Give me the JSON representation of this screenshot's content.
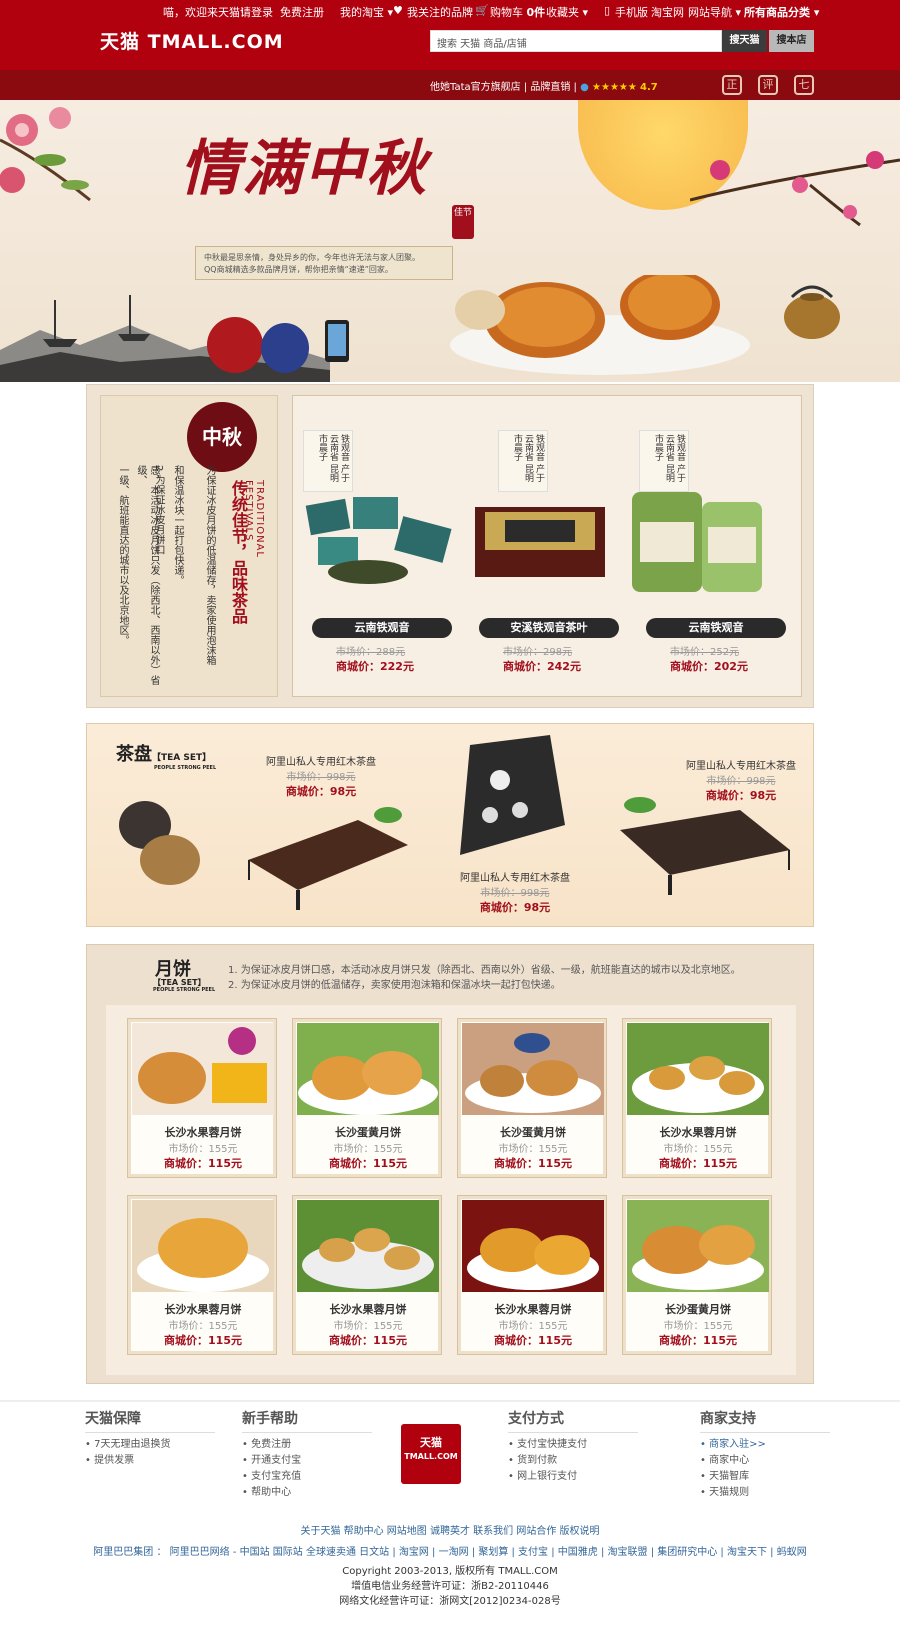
{
  "topnav": {
    "welcome": "喵，欢迎来天猫!",
    "login": "请登录",
    "register": "免费注册",
    "my_taobao": "我的淘宝",
    "fav_brands": "我关注的品牌",
    "cart": "购物车",
    "cart_count": "0件",
    "favorites": "收藏夹",
    "mobile": "手机版",
    "taobao": "淘宝网",
    "site_nav": "网站导航",
    "all_categories": "所有商品分类"
  },
  "logo": "天猫 TMALL.COM",
  "search": {
    "value": "搜索 天猫 商品/店铺",
    "btn_tmall": "搜天猫",
    "btn_shop": "搜本店"
  },
  "shop": {
    "name": "他她Tata官方旗舰店",
    "tag": "品牌直销",
    "stars": "★★★★★",
    "score": "4.7",
    "icons": [
      "正",
      "评",
      "七"
    ]
  },
  "banner": {
    "title": "情满中秋",
    "seal": "佳节",
    "note_line1": "中秋最是思亲情，身处异乡的你，今年也许无法与家人团聚。",
    "note_line2": "QQ商城精选多款品牌月饼，帮你把亲情“速递”回家。"
  },
  "sec1": {
    "seal": "中秋",
    "title": "传统佳节，品味茶品",
    "eng": "TRADITIONAL FESTIVALS",
    "text_cols": [
      "为保证冰皮月饼的低温储存，卖家使用泡沫箱",
      "和保温冰块一起打包快递。",
      "2.为保证冰皮月饼口",
      "感，本活动冰皮月饼只发（除西北、西南以外）省级、",
      "一级、航班能直达的城市以及北京地区。"
    ],
    "teas": [
      {
        "labels": "铁观音 产于云南省 昆明市晨子",
        "name": "云南铁观音",
        "market": "市场价：288元",
        "sale": "商城价：222元"
      },
      {
        "labels": "铁观音 产于云南省 昆明市晨子",
        "name": "安溪铁观音茶叶",
        "market": "市场价：298元",
        "sale": "商城价：242元"
      },
      {
        "labels": "铁观音 产于云南省 昆明市晨子",
        "name": "云南铁观音",
        "market": "市场价：252元",
        "sale": "商城价：202元"
      }
    ]
  },
  "sec2": {
    "label": "茶盘",
    "label_en": "【TEA SET】",
    "label_sub": "PEOPLE STRONG PEEL",
    "products": [
      {
        "name": "阿里山私人专用红木茶盘",
        "market": "市场价：998元",
        "sale": "商城价：98元"
      },
      {
        "name": "阿里山私人专用红木茶盘",
        "market": "市场价：998元",
        "sale": "商城价：98元"
      },
      {
        "name": "阿里山私人专用红木茶盘",
        "market": "市场价：998元",
        "sale": "商城价：98元"
      }
    ]
  },
  "sec3": {
    "label": "月饼",
    "label_en": "【TEA SET】",
    "label_sub": "PEOPLE STRONG PEEL",
    "note1": "1. 为保证冰皮月饼口感，本活动冰皮月饼只发（除西北、西南以外）省级、一级，航班能直达的城市以及北京地区。",
    "note2": "2. 为保证冰皮月饼的低温储存，卖家使用泡沫箱和保温冰块一起打包快递。",
    "cakes": [
      {
        "name": "长沙水果蓉月饼",
        "market": "市场价：155元",
        "sale": "商城价：115元"
      },
      {
        "name": "长沙蛋黄月饼",
        "market": "市场价：155元",
        "sale": "商城价：115元"
      },
      {
        "name": "长沙蛋黄月饼",
        "market": "市场价：155元",
        "sale": "商城价：115元"
      },
      {
        "name": "长沙水果蓉月饼",
        "market": "市场价：155元",
        "sale": "商城价：115元"
      },
      {
        "name": "长沙水果蓉月饼",
        "market": "市场价：155元",
        "sale": "商城价：115元"
      },
      {
        "name": "长沙水果蓉月饼",
        "market": "市场价：155元",
        "sale": "商城价：115元"
      },
      {
        "name": "长沙水果蓉月饼",
        "market": "市场价：155元",
        "sale": "商城价：115元"
      },
      {
        "name": "长沙蛋黄月饼",
        "market": "市场价：155元",
        "sale": "商城价：115元"
      }
    ]
  },
  "footer": {
    "cols": [
      {
        "title": "天猫保障",
        "items": [
          "7天无理由退换货",
          "提供发票"
        ]
      },
      {
        "title": "新手帮助",
        "items": [
          "免费注册",
          "开通支付宝",
          "支付宝充值",
          "帮助中心"
        ]
      },
      {
        "title": "支付方式",
        "items": [
          "支付宝快捷支付",
          "货到付款",
          "网上银行支付"
        ]
      },
      {
        "title": "商家支持",
        "items": [
          "商家入驻>>",
          "商家中心",
          "天猫智库",
          "天猫规则"
        ]
      }
    ],
    "badge_line1": "天猫",
    "badge_line2": "TMALL.COM",
    "links": "关于天猫  帮助中心  网站地图  诚聘英才  联系我们  网站合作  版权说明",
    "links2": "阿里巴巴集团 ： 阿里巴巴网络 - 中国站  国际站  全球速卖通  日文站 | 淘宝网 | 一淘网 | 聚划算 | 支付宝 | 中国雅虎 | 淘宝联盟 | 集团研究中心 | 淘宝天下 | 蚂蚁网",
    "copy1": "Copyright 2003-2013, 版权所有 TMALL.COM",
    "copy2": "增值电信业务经营许可证：浙B2-20110446",
    "copy3": "网络文化经营许可证：浙网文[2012]0234-028号"
  },
  "colors": {
    "brand": "#b1000e",
    "accent": "#a10e1c"
  }
}
